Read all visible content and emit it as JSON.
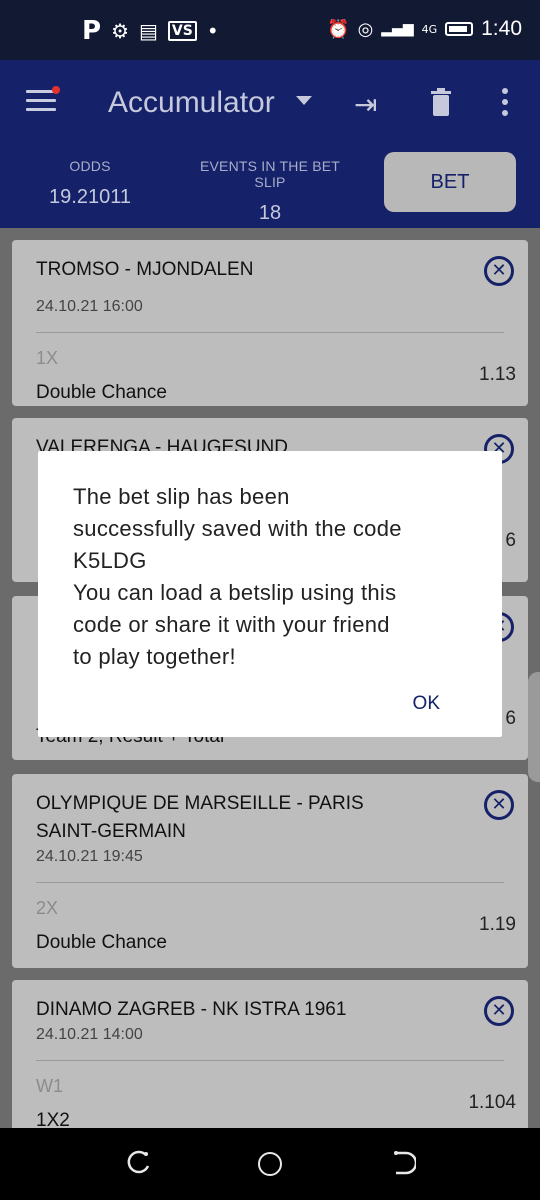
{
  "status_bar": {
    "app_icons": [
      "P",
      "⚙",
      "▤",
      "VS",
      "•"
    ],
    "right_icons": [
      "⏰",
      "◎",
      "📶"
    ],
    "network": "4G",
    "time": "1:40"
  },
  "header": {
    "title": "Accumulator",
    "odds_label": "ODDS",
    "odds_value": "19.21011",
    "events_label": "EVENTS IN THE BET SLIP",
    "events_value": "18",
    "bet_label": "BET"
  },
  "events": [
    {
      "teams": "TROMSO - MJONDALEN",
      "datetime": "24.10.21 16:00",
      "pick": "1X",
      "market": "Double Chance",
      "odd": "1.13"
    },
    {
      "teams": "VALERENGA - HAUGESUND",
      "datetime": "",
      "pick": "",
      "market": "",
      "odd": "6"
    },
    {
      "teams": "",
      "datetime": "",
      "pick": "",
      "market": "Team 2, Result + Total",
      "odd": "6"
    },
    {
      "teams": "OLYMPIQUE DE MARSEILLE - PARIS SAINT-GERMAIN",
      "datetime": "24.10.21 19:45",
      "pick": "2X",
      "market": "Double Chance",
      "odd": "1.19"
    },
    {
      "teams": "DINAMO ZAGREB - NK ISTRA 1961",
      "datetime": "24.10.21 14:00",
      "pick": "W1",
      "market": "1X2",
      "odd": "1.104"
    }
  ],
  "dialog": {
    "message": "The bet slip has been successfully saved with the code K5LDG\nYou can load a betslip using this code or share it with your friend to play together!",
    "line1": "The bet slip has been",
    "line2": "successfully saved with the code",
    "line3": "K5LDG",
    "line4": "You can load a betslip using this",
    "line5": "code or share it with your friend",
    "line6": "to play together!",
    "ok_label": "OK"
  },
  "colors": {
    "header_bg": "#152168",
    "status_bg": "#121933",
    "card_bg": "#bdbdbd",
    "accent": "#152168",
    "badge_red": "#e3332b"
  }
}
